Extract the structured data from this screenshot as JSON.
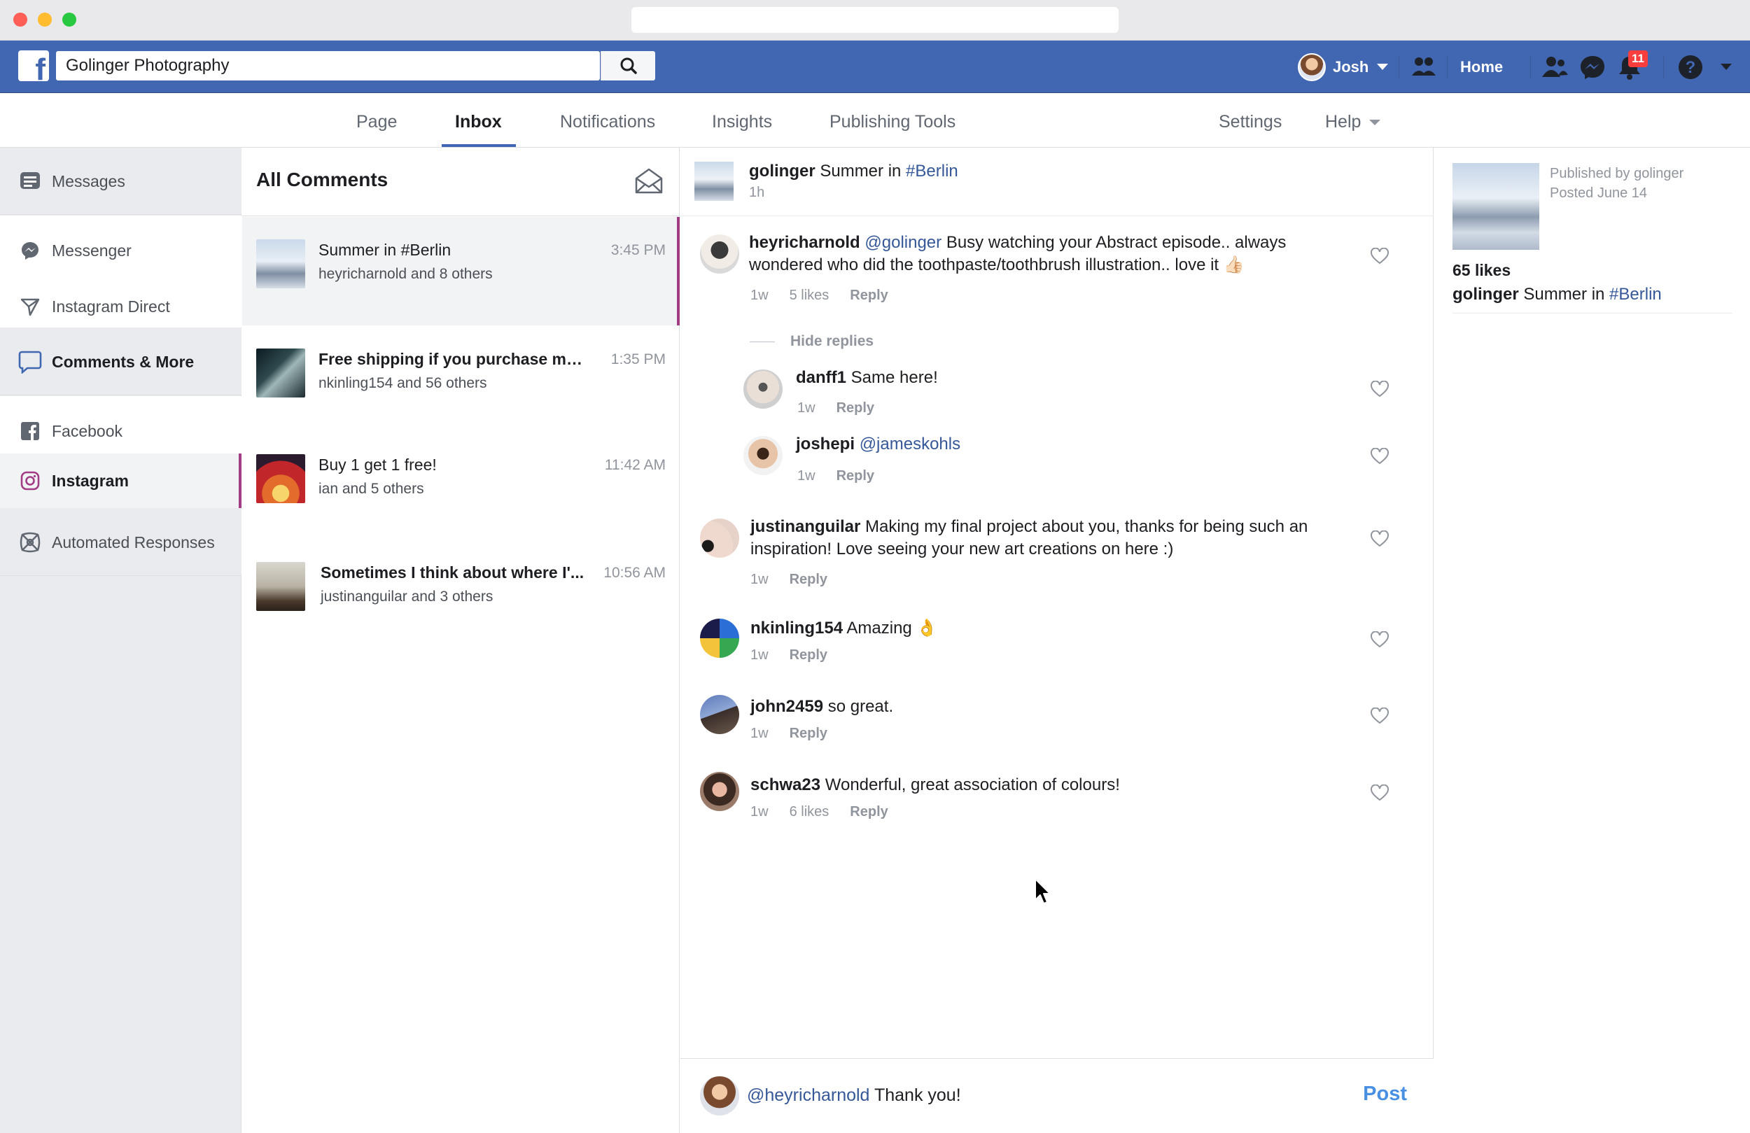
{
  "window": {
    "url_text": ""
  },
  "topbar": {
    "search_value": "Golinger Photography",
    "user_name": "Josh",
    "home_label": "Home",
    "notification_count": "11"
  },
  "subnav": {
    "tabs": [
      "Page",
      "Inbox",
      "Notifications",
      "Insights",
      "Publishing Tools"
    ],
    "settings_label": "Settings",
    "help_label": "Help"
  },
  "sidebar": {
    "messages": "Messages",
    "messenger": "Messenger",
    "instagram_direct": "Instagram Direct",
    "comments_more": "Comments & More",
    "facebook": "Facebook",
    "instagram": "Instagram",
    "automated_responses": "Automated Responses"
  },
  "list": {
    "header": "All Comments",
    "items": [
      {
        "title": "Summer in #Berlin",
        "subtitle": "heyricharnold and 8 others",
        "time": "3:45 PM"
      },
      {
        "title": "Free shipping if you purchase mo ...",
        "subtitle": "nkinling154 and 56 others",
        "time": "1:35 PM"
      },
      {
        "title": "Buy 1 get 1 free!",
        "subtitle": "ian and 5 others",
        "time": "11:42 AM"
      },
      {
        "title": "Sometimes I think about where I'...",
        "subtitle": "justinanguilar and 3 others",
        "time": "10:56 AM"
      }
    ]
  },
  "post": {
    "author": "golinger",
    "caption": "Summer in",
    "hashtag": "#Berlin",
    "age": "1h"
  },
  "comments": {
    "c1": {
      "user": "heyricharnold",
      "mention": "@golinger",
      "text1": "Busy watching your Abstract episode.. always",
      "text2": "wondered who did the toothpaste/toothbrush illustration.. love it 👍🏻",
      "age": "1w",
      "likes": "5 likes",
      "reply": "Reply"
    },
    "hide_replies": "Hide replies",
    "r1": {
      "user": "danff1",
      "text": "Same here!",
      "age": "1w",
      "reply": "Reply"
    },
    "r2": {
      "user": "joshepi",
      "mention": "@jameskohls",
      "age": "1w",
      "reply": "Reply"
    },
    "c2": {
      "user": "justinanguilar",
      "text1": "Making my final project about you, thanks for being such an",
      "text2": "inspiration! Love seeing your new art creations on here :)",
      "age": "1w",
      "reply": "Reply"
    },
    "c3": {
      "user": "nkinling154",
      "text": "Amazing 👌",
      "age": "1w",
      "reply": "Reply"
    },
    "c4": {
      "user": "john2459",
      "text": "so great.",
      "age": "1w",
      "reply": "Reply"
    },
    "c5": {
      "user": "schwa23",
      "text": "Wonderful, great association of colours!",
      "age": "1w",
      "likes": "6 likes",
      "reply": "Reply"
    }
  },
  "composer": {
    "mention": "@heyricharnold",
    "text": "Thank you!",
    "post_label": "Post"
  },
  "details": {
    "published_by": "Published by golinger",
    "posted": "Posted June 14",
    "likes": "65 likes",
    "author": "golinger",
    "caption": "Summer in",
    "hashtag": "#Berlin"
  },
  "colors": {
    "brand": "#4267b2",
    "instagram_accent": "#a23d85",
    "link": "#365899",
    "post_button": "#4a90e2"
  }
}
